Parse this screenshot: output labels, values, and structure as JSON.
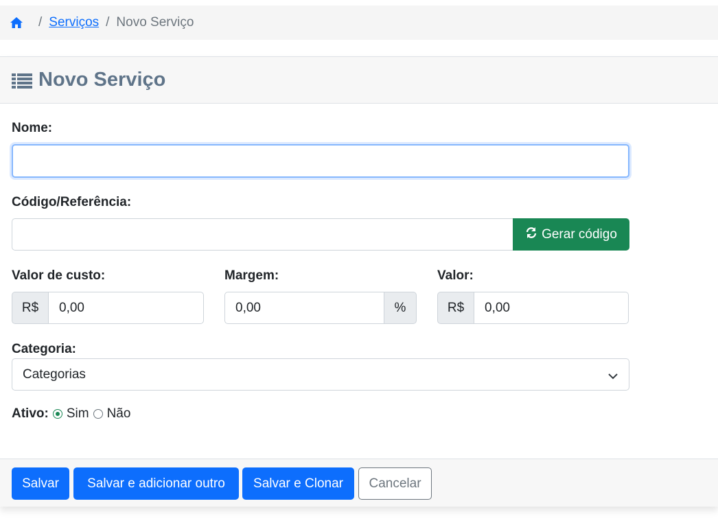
{
  "breadcrumb": {
    "home_icon": "home-icon",
    "separator": "/",
    "services_link": "Serviços",
    "current": "Novo Serviço"
  },
  "header": {
    "icon": "list-icon",
    "title": "Novo Serviço"
  },
  "form": {
    "nome": {
      "label": "Nome:",
      "value": ""
    },
    "codigo": {
      "label": "Código/Referência:",
      "value": "",
      "button_label": "Gerar código",
      "button_icon": "refresh-icon"
    },
    "valor_custo": {
      "label": "Valor de custo:",
      "prefix": "R$",
      "value": "0,00"
    },
    "margem": {
      "label": "Margem:",
      "value": "0,00",
      "suffix": "%"
    },
    "valor": {
      "label": "Valor:",
      "prefix": "R$",
      "value": "0,00"
    },
    "categoria": {
      "label": "Categoria:",
      "selected": "Categorias"
    },
    "ativo": {
      "label": "Ativo:",
      "options": [
        "Sim",
        "Não"
      ],
      "selected": "Sim"
    }
  },
  "footer": {
    "save": "Salvar",
    "save_add": "Salvar e adicionar outro",
    "save_clone": "Salvar e Clonar",
    "cancel": "Cancelar"
  },
  "colors": {
    "primary": "#0d6efd",
    "success": "#198754",
    "header_text": "#5f7489"
  }
}
